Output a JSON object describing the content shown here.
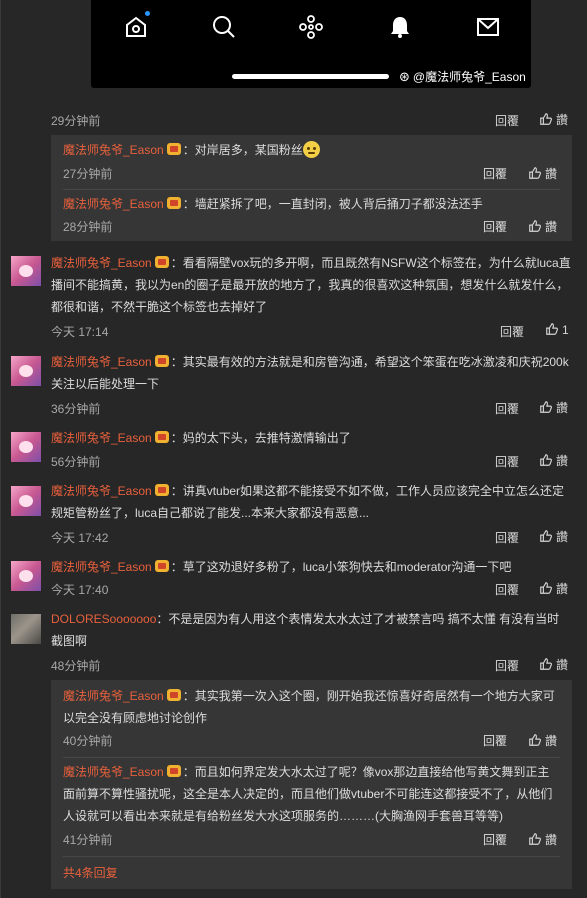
{
  "image_watermark": "@魔法师兔爷_Eason",
  "icons": [
    "home-icon",
    "search-icon",
    "community-icon",
    "notification-icon",
    "mail-icon"
  ],
  "reply_label": "回覆",
  "like_label": "讚",
  "first_time": "29分钟前",
  "subs_a": [
    {
      "name": "魔法师兔爷_Eason",
      "text": "：对岸居多，某国粉丝",
      "time": "27分钟前"
    },
    {
      "name": "魔法师兔爷_Eason",
      "text": "：墙赶紧拆了吧，一直封闭，被人背后捅刀子都没法还手",
      "time": "28分钟前"
    }
  ],
  "comments": [
    {
      "name": "魔法师兔爷_Eason",
      "line1": "：看看隔壁vox玩的多开啊，而且既然有NSFW这个标签在，为什么就luca直",
      "line2": "播间不能搞黄，我以为en的圈子是最开放的地方了，我真的很喜欢这种氛围，想发什么就发什么，",
      "line3": "都很和谐，不然干脆这个标签也去掉好了",
      "time": "今天 17:14",
      "likes": "1"
    },
    {
      "name": "魔法师兔爷_Eason",
      "line1": "：其实最有效的方法就是和房管沟通，希望这个笨蛋在吃冰激凌和庆祝200k",
      "line2": "关注以后能处理一下",
      "time": "36分钟前"
    },
    {
      "name": "魔法师兔爷_Eason",
      "line1": "：妈的太下头，去推特激情输出了",
      "time": "56分钟前"
    },
    {
      "name": "魔法师兔爷_Eason",
      "line1": "：讲真vtuber如果这都不能接受不如不做，工作人员应该完全中立怎么还定",
      "line2": "规矩管粉丝了，luca自己都说了能发...本来大家都没有恶意...",
      "time": "今天 17:42"
    },
    {
      "name": "魔法师兔爷_Eason",
      "line1": "：草了这劝退好多粉了，luca小笨狗快去和moderator沟通一下吧",
      "time": "今天 17:40"
    },
    {
      "name": "DOLORESooooooo",
      "line1": "：不是是因为有人用这个表情发太水太过了才被禁言吗 搞不太懂 有没有当时",
      "line2": "截图啊",
      "time": "48分钟前"
    }
  ],
  "subs_b": [
    {
      "name": "魔法师兔爷_Eason",
      "line1": "：其实我第一次入这个圈，刚开始我还惊喜好奇居然有一个地方大家可",
      "line2": "以完全没有顾虑地讨论创作",
      "time": "40分钟前"
    },
    {
      "name": "魔法师兔爷_Eason",
      "line1": "：而且如何界定发大水太过了呢？像vox那边直接给他写黄文舞到正主",
      "line2": "面前算不算性骚扰呢，这全是本人决定的，而且他们做vtuber不可能连这都接受不了，从他们",
      "line3": "人设就可以看出本来就是有给粉丝发大水这项服务的………(大胸渔网手套兽耳等等)",
      "time": "41分钟前"
    }
  ],
  "more_replies": "共4条回复"
}
